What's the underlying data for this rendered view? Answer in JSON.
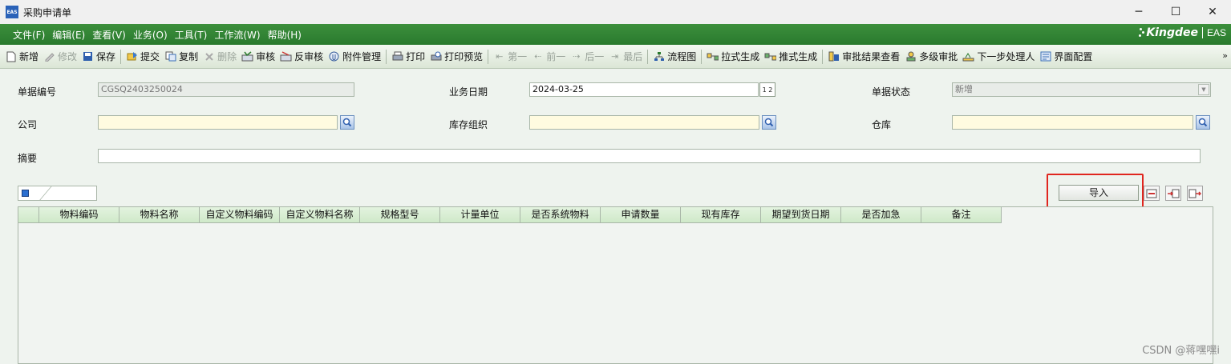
{
  "window": {
    "app_icon_text": "EAS",
    "title": "采购申请单",
    "minimize": "─",
    "maximize": "☐",
    "close": "✕"
  },
  "menu": {
    "items": [
      "文件(F)",
      "编辑(E)",
      "查看(V)",
      "业务(O)",
      "工具(T)",
      "工作流(W)",
      "帮助(H)"
    ],
    "brand": "Kingdee",
    "brand_suffix": "EAS"
  },
  "toolbar": {
    "buttons": [
      {
        "label": "新增",
        "icon": "new-doc-icon",
        "enabled": true
      },
      {
        "label": "修改",
        "icon": "edit-pen-icon",
        "enabled": false
      },
      {
        "label": "保存",
        "icon": "save-disk-icon",
        "enabled": true
      },
      {
        "label": "提交",
        "icon": "submit-icon",
        "enabled": true
      },
      {
        "label": "复制",
        "icon": "copy-icon",
        "enabled": true
      },
      {
        "label": "删除",
        "icon": "delete-x-icon",
        "enabled": false
      },
      {
        "label": "审核",
        "icon": "audit-icon",
        "enabled": true
      },
      {
        "label": "反审核",
        "icon": "unaudit-icon",
        "enabled": true
      },
      {
        "label": "附件管理",
        "icon": "attachment-icon",
        "enabled": true
      },
      {
        "label": "打印",
        "icon": "print-icon",
        "enabled": true
      },
      {
        "label": "打印预览",
        "icon": "print-preview-icon",
        "enabled": true
      },
      {
        "label": "第一",
        "icon": "first-arrow-icon",
        "enabled": false
      },
      {
        "label": "前一",
        "icon": "prev-arrow-icon",
        "enabled": false
      },
      {
        "label": "后一",
        "icon": "next-arrow-icon",
        "enabled": false
      },
      {
        "label": "最后",
        "icon": "last-arrow-icon",
        "enabled": false
      },
      {
        "label": "流程图",
        "icon": "flowchart-icon",
        "enabled": true
      },
      {
        "label": "拉式生成",
        "icon": "pull-generate-icon",
        "enabled": true
      },
      {
        "label": "推式生成",
        "icon": "push-generate-icon",
        "enabled": true
      },
      {
        "label": "审批结果查看",
        "icon": "approval-result-icon",
        "enabled": true
      },
      {
        "label": "多级审批",
        "icon": "multi-approval-icon",
        "enabled": true
      },
      {
        "label": "下一步处理人",
        "icon": "next-handler-icon",
        "enabled": true
      },
      {
        "label": "界面配置",
        "icon": "ui-config-icon",
        "enabled": true
      }
    ],
    "more": "»"
  },
  "form": {
    "doc_no_label": "单据编号",
    "doc_no_value": "CGSQ2403250024",
    "biz_date_label": "业务日期",
    "biz_date_value": "2024-03-25",
    "cal_text": "1 2",
    "doc_status_label": "单据状态",
    "doc_status_value": "新增",
    "company_label": "公司",
    "company_value": "",
    "stock_org_label": "库存组织",
    "stock_org_value": "",
    "warehouse_label": "仓库",
    "warehouse_value": "",
    "summary_label": "摘要",
    "summary_value": ""
  },
  "grid": {
    "import_label": "导入",
    "columns": [
      "物料编码",
      "物料名称",
      "自定义物料编码",
      "自定义物料名称",
      "规格型号",
      "计量单位",
      "是否系统物料",
      "申请数量",
      "现有库存",
      "期望到货日期",
      "是否加急",
      "备注"
    ]
  },
  "watermark": "CSDN @蒋嘿嘿i",
  "colors": {
    "menubar": "#2e7f31",
    "highlight": "#e0261f",
    "grid_header": "#d6edd1",
    "lookup": "#a9c4e8"
  }
}
